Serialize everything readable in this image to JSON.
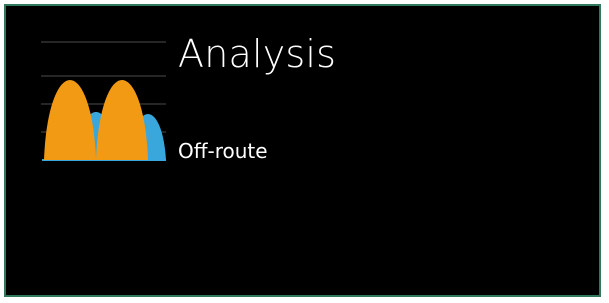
{
  "tile": {
    "title": "Analysis",
    "subtitle": "Off-route",
    "icon": "analysis-icon",
    "colors": {
      "background": "#000000",
      "border": "#2f7a5c",
      "text": "#ffffff",
      "peak_orange": "#f39a14",
      "peak_blue": "#3aa7dc",
      "gridline": "#555555"
    }
  }
}
